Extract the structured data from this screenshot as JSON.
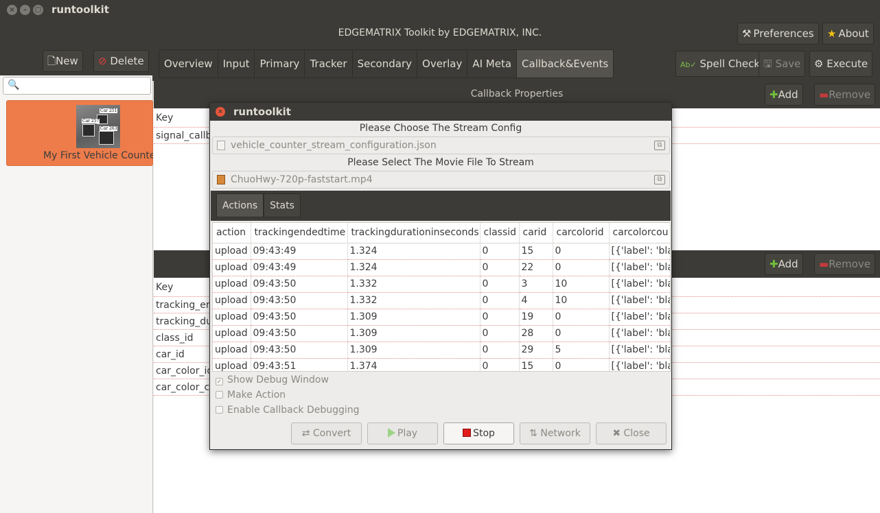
{
  "window": {
    "app_title": "runtoolkit",
    "header_title": "EDGEMATRIX Toolkit by EDGEMATRIX, INC.",
    "preferences_label": "Preferences",
    "about_label": "About"
  },
  "left": {
    "new_label": "New",
    "delete_label": "Delete",
    "search_placeholder": "",
    "config_item": {
      "label": "My First Vehicle Counter",
      "thumb_tags": [
        "Car 251",
        "Car 257",
        "Car 263"
      ]
    }
  },
  "tabs": [
    "Overview",
    "Input",
    "Primary",
    "Tracker",
    "Secondary",
    "Overlay",
    "AI Meta",
    "Callback&Events"
  ],
  "active_tab": "Callback&Events",
  "toolbar": {
    "spell_check_label": "Spell Check",
    "save_label": "Save",
    "execute_label": "Execute"
  },
  "callback_section": {
    "title": "Callback Properties",
    "add_label": "Add",
    "remove_label": "Remove",
    "key_header": "Key",
    "rows": [
      "signal_callb"
    ]
  },
  "event_section": {
    "add_label": "Add",
    "remove_label": "Remove",
    "key_header": "Key",
    "rows": [
      "tracking_en",
      "tracking_du",
      "class_id",
      "car_id",
      "car_color_ic",
      "car_color_c"
    ]
  },
  "dialog": {
    "title": "runtoolkit",
    "stream_config_label": "Please Choose The Stream Config",
    "stream_config_file": "vehicle_counter_stream_configuration.json",
    "movie_label": "Please Select The Movie File To Stream",
    "movie_file": "ChuoHwy-720p-faststart.mp4",
    "tabs": [
      "Actions",
      "Stats"
    ],
    "active_tab": "Actions",
    "table": {
      "columns": [
        "action",
        "trackingendedtime",
        "trackingdurationinseconds",
        "classid",
        "carid",
        "carcolorid",
        "carcolorcou"
      ],
      "rows": [
        [
          "upload",
          "09:43:49",
          "1.324",
          "0",
          "15",
          "0",
          "[{'label': 'blac"
        ],
        [
          "upload",
          "09:43:49",
          "1.324",
          "0",
          "22",
          "0",
          "[{'label': 'blac"
        ],
        [
          "upload",
          "09:43:50",
          "1.332",
          "0",
          "3",
          "10",
          "[{'label': 'blac"
        ],
        [
          "upload",
          "09:43:50",
          "1.332",
          "0",
          "4",
          "10",
          "[{'label': 'blac"
        ],
        [
          "upload",
          "09:43:50",
          "1.309",
          "0",
          "19",
          "0",
          "[{'label': 'blac"
        ],
        [
          "upload",
          "09:43:50",
          "1.309",
          "0",
          "28",
          "0",
          "[{'label': 'blac"
        ],
        [
          "upload",
          "09:43:50",
          "1.309",
          "0",
          "29",
          "5",
          "[{'label': 'blac"
        ],
        [
          "upload",
          "09:43:51",
          "1.374",
          "0",
          "15",
          "0",
          "[{'label': 'blac"
        ]
      ]
    },
    "checkboxes": [
      {
        "label": "Show Debug Window",
        "checked": true
      },
      {
        "label": "Make Action",
        "checked": false
      },
      {
        "label": "Enable Callback Debugging",
        "checked": false
      }
    ],
    "buttons": {
      "convert": "Convert",
      "play": "Play",
      "stop": "Stop",
      "network": "Network",
      "close": "Close"
    }
  }
}
